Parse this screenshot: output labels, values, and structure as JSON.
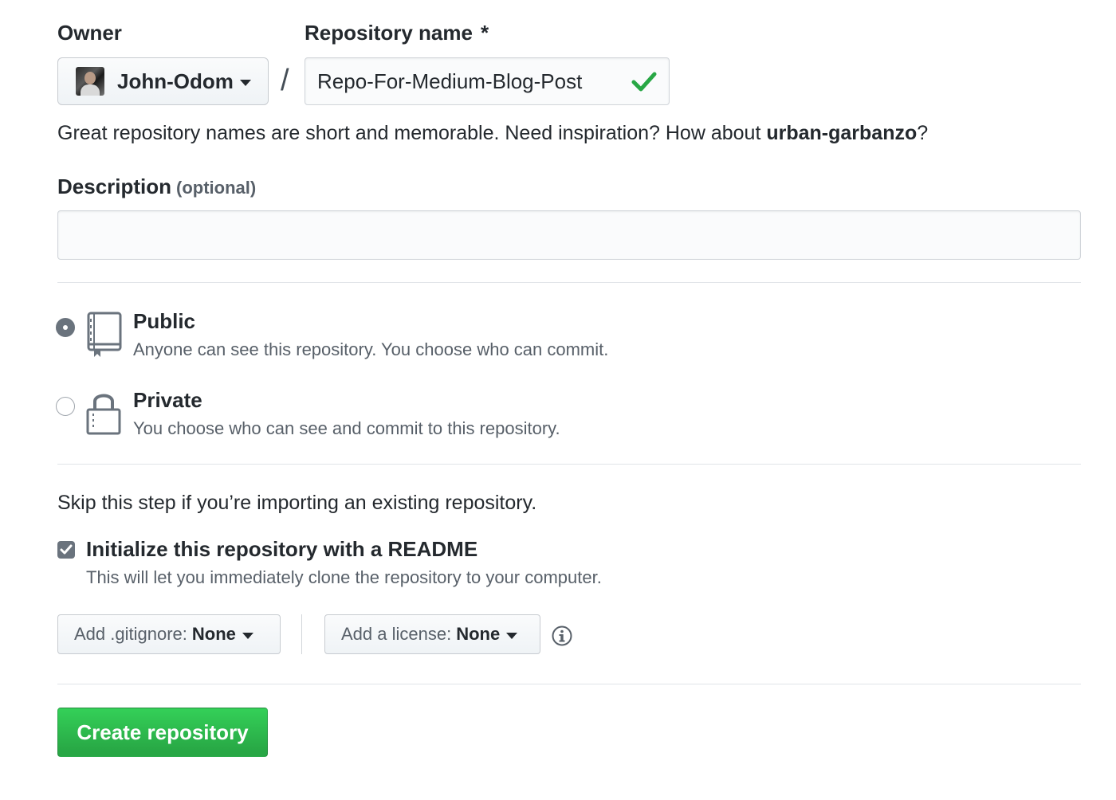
{
  "owner": {
    "label": "Owner",
    "selected": "John-Odom"
  },
  "repository": {
    "label": "Repository name",
    "required_marker": "*",
    "separator": "/",
    "value": "Repo-For-Medium-Blog-Post",
    "valid": true,
    "hint_prefix": "Great repository names are short and memorable. Need inspiration? How about ",
    "hint_suggestion": "urban-garbanzo",
    "hint_suffix": "?"
  },
  "description": {
    "label": "Description",
    "optional": "(optional)",
    "value": ""
  },
  "visibility": {
    "selected": "public",
    "public": {
      "title": "Public",
      "description": "Anyone can see this repository. You choose who can commit.",
      "icon": "repo-icon"
    },
    "private": {
      "title": "Private",
      "description": "You choose who can see and commit to this repository.",
      "icon": "lock-icon"
    }
  },
  "init": {
    "skip_text": "Skip this step if you’re importing an existing repository.",
    "readme_label": "Initialize this repository with a README",
    "readme_description": "This will let you immediately clone the repository to your computer.",
    "readme_checked": true
  },
  "gitignore": {
    "prefix": "Add .gitignore:",
    "value": "None"
  },
  "license": {
    "prefix": "Add a license:",
    "value": "None"
  },
  "submit": {
    "label": "Create repository"
  },
  "colors": {
    "primary_green": "#28a745",
    "valid_check": "#28a745",
    "text": "#24292e",
    "muted": "#586069"
  }
}
